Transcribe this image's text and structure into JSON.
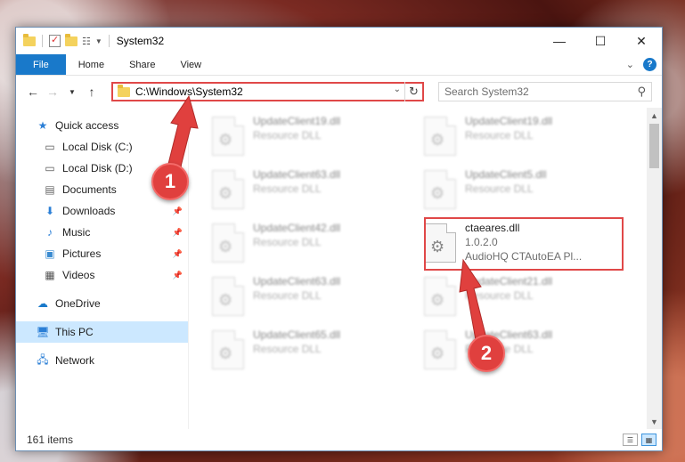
{
  "window": {
    "title": "System32",
    "controls": {
      "minimize": "—",
      "maximize": "☐",
      "close": "✕"
    }
  },
  "ribbon": {
    "tabs": [
      "File",
      "Home",
      "Share",
      "View"
    ]
  },
  "nav": {
    "address": "C:\\Windows\\System32",
    "search_placeholder": "Search System32"
  },
  "sidebar": {
    "items": [
      {
        "label": "Quick access",
        "icon": "star-icon",
        "pinned": false
      },
      {
        "label": "Local Disk (C:)",
        "icon": "drive-icon",
        "pinned": false
      },
      {
        "label": "Local Disk (D:)",
        "icon": "drive-icon",
        "pinned": true
      },
      {
        "label": "Documents",
        "icon": "documents-icon",
        "pinned": true
      },
      {
        "label": "Downloads",
        "icon": "download-icon",
        "pinned": true
      },
      {
        "label": "Music",
        "icon": "music-icon",
        "pinned": true
      },
      {
        "label": "Pictures",
        "icon": "pictures-icon",
        "pinned": true
      },
      {
        "label": "Videos",
        "icon": "videos-icon",
        "pinned": true
      },
      {
        "label": "OneDrive",
        "icon": "cloud-icon"
      },
      {
        "label": "This PC",
        "icon": "computer-icon",
        "selected": true
      },
      {
        "label": "Network",
        "icon": "network-icon"
      }
    ]
  },
  "files": [
    {
      "name": "UpdateClient19.dll",
      "line1": "Resource DLL",
      "line2": ""
    },
    {
      "name": "UpdateClient19.dll",
      "line1": "Resource DLL",
      "line2": ""
    },
    {
      "name": "UpdateClient63.dll",
      "line1": "Resource DLL",
      "line2": ""
    },
    {
      "name": "UpdateClient5.dll",
      "line1": "Resource DLL",
      "line2": ""
    },
    {
      "name": "UpdateClient42.dll",
      "line1": "Resource DLL",
      "line2": ""
    },
    {
      "name": "ctaeares.dll",
      "line1": "1.0.2.0",
      "line2": "AudioHQ CTAutoEA Pl..."
    },
    {
      "name": "UpdateClient63.dll",
      "line1": "Resource DLL",
      "line2": ""
    },
    {
      "name": "UpdateClient21.dll",
      "line1": "Resource DLL",
      "line2": ""
    },
    {
      "name": "UpdateClient65.dll",
      "line1": "Resource DLL",
      "line2": ""
    },
    {
      "name": "UpdateClient63.dll",
      "line1": "Resource DLL",
      "line2": ""
    }
  ],
  "status": {
    "item_count": "161 items"
  },
  "annotations": {
    "step1": "1",
    "step2": "2",
    "color": "#e0403e"
  }
}
